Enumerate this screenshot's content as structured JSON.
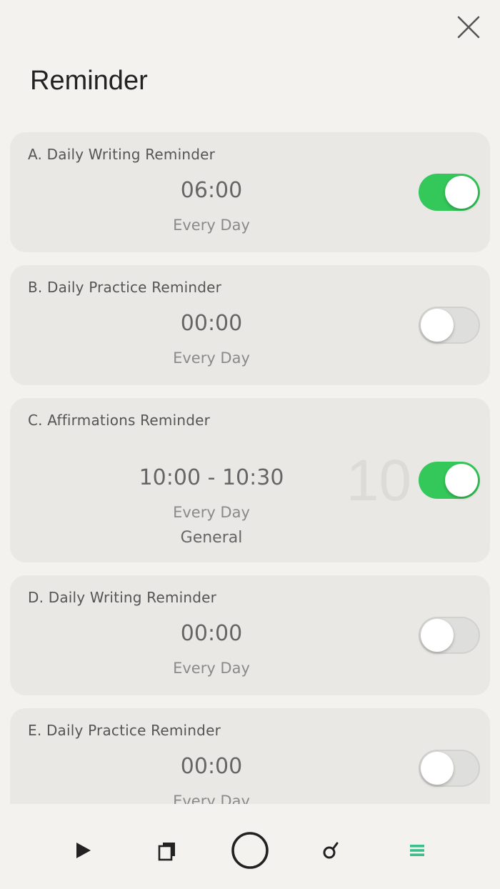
{
  "header": {
    "title": "Reminder",
    "close_icon": "close-icon"
  },
  "reminders": [
    {
      "title": "A. Daily Writing Reminder",
      "time": "06:00",
      "repeat": "Every Day",
      "enabled": true
    },
    {
      "title": "B. Daily Practice Reminder",
      "time": "00:00",
      "repeat": "Every Day",
      "enabled": false
    },
    {
      "title": "C. Affirmations Reminder",
      "time": "10:00 - 10:30",
      "repeat": "Every Day",
      "category": "General",
      "badge": "10",
      "enabled": true
    },
    {
      "title": "D. Daily Writing Reminder",
      "time": "00:00",
      "repeat": "Every Day",
      "enabled": false
    },
    {
      "title": "E. Daily Practice Reminder",
      "time": "00:00",
      "repeat": "Every Day",
      "enabled": false
    }
  ],
  "tabbar": {
    "tabs": [
      {
        "icon": "play-icon"
      },
      {
        "icon": "pages-icon"
      },
      {
        "icon": "circle-icon"
      },
      {
        "icon": "magnifier-icon"
      },
      {
        "icon": "menu-icon",
        "active": true
      }
    ]
  },
  "colors": {
    "toggle_on": "#34c759",
    "tab_active": "#3bbf8a",
    "background": "#f3f2ee",
    "card": "#e9e8e5"
  }
}
